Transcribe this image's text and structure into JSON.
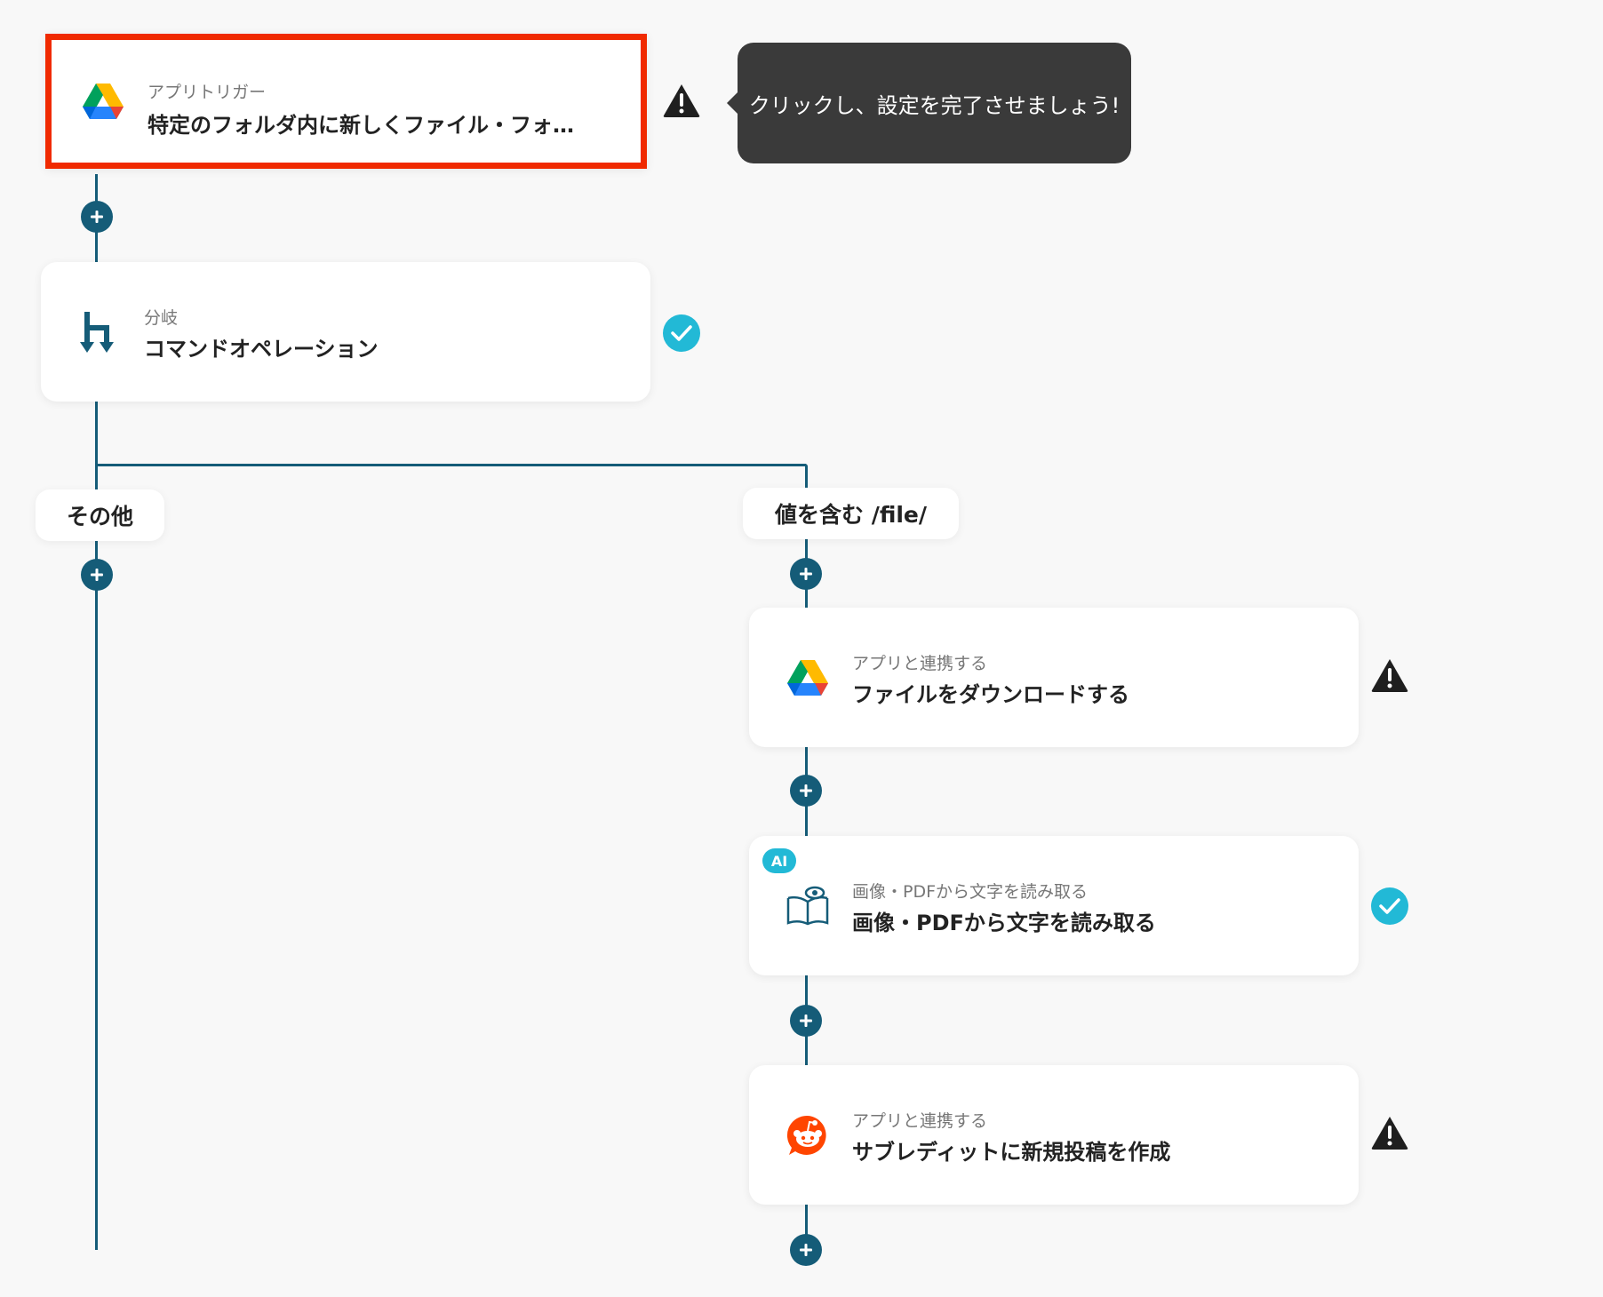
{
  "tooltip": {
    "text": "クリックし、設定を完了させましょう!"
  },
  "steps": [
    {
      "subtitle": "アプリトリガー",
      "title": "特定のフォルダ内に新しくファイル・フォ…",
      "status": "warning"
    },
    {
      "subtitle": "分岐",
      "title": "コマンドオペレーション",
      "status": "done"
    },
    {
      "subtitle": "アプリと連携する",
      "title": "ファイルをダウンロードする",
      "status": "warning"
    },
    {
      "subtitle": "画像・PDFから文字を読み取る",
      "title": "画像・PDFから文字を読み取る",
      "status": "done",
      "badge": "AI"
    },
    {
      "subtitle": "アプリと連携する",
      "title": "サブレディットに新規投稿を作成",
      "status": "warning"
    }
  ],
  "branches": {
    "left": "その他",
    "right": "値を含む /file/"
  },
  "colors": {
    "line": "#155c78",
    "highlight": "#f02a00",
    "done": "#22b9d6",
    "warning": "#1f1f1f"
  },
  "icons": {
    "step0": "google-drive-icon",
    "step1": "branch-icon",
    "step2": "google-drive-icon",
    "step3": "ocr-book-icon",
    "step4": "reddit-icon"
  }
}
